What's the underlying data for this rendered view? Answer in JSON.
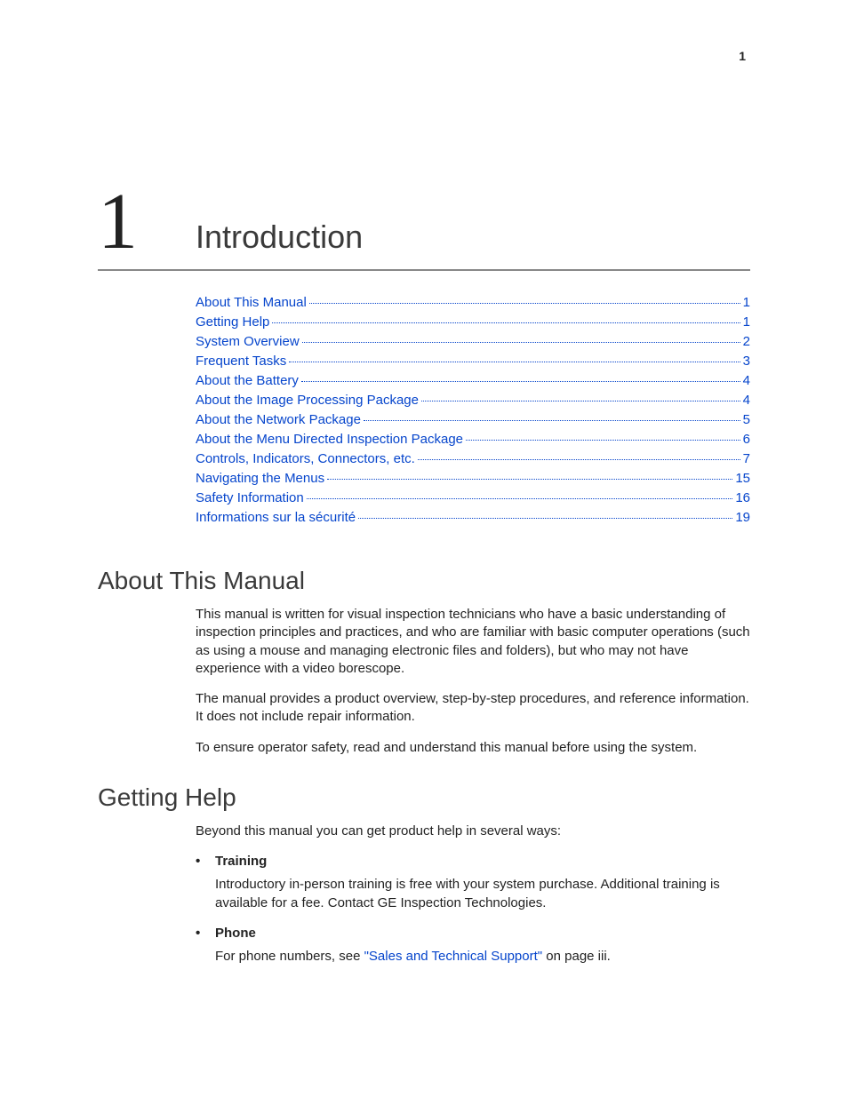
{
  "page_number_top": "1",
  "chapter": {
    "number": "1",
    "title": "Introduction"
  },
  "toc": [
    {
      "title": "About This Manual",
      "page": "1"
    },
    {
      "title": "Getting Help",
      "page": "1"
    },
    {
      "title": "System Overview",
      "page": "2"
    },
    {
      "title": "Frequent Tasks",
      "page": "3"
    },
    {
      "title": "About the Battery",
      "page": "4"
    },
    {
      "title": "About the Image Processing Package",
      "page": "4"
    },
    {
      "title": "About the Network Package",
      "page": "5"
    },
    {
      "title": "About the Menu Directed Inspection Package",
      "page": "6"
    },
    {
      "title": "Controls, Indicators, Connectors, etc.",
      "page": "7"
    },
    {
      "title": "Navigating the Menus",
      "page": "15"
    },
    {
      "title": "Safety Information",
      "page": "16"
    },
    {
      "title": "Informations sur la sécurité",
      "page": "19"
    }
  ],
  "sections": {
    "about_manual": {
      "heading": "About This Manual",
      "p1": "This manual is written for visual inspection technicians who have a basic understanding of inspection principles and practices, and who are familiar with basic computer operations (such as using a mouse and managing electronic files and folders), but who may not have experience with a video borescope.",
      "p2": "The manual provides a product overview, step-by-step procedures, and reference information. It does not include repair information.",
      "p3": "To ensure operator safety, read and understand this manual before using the system."
    },
    "getting_help": {
      "heading": "Getting Help",
      "intro": "Beyond this manual you can get product help in several ways:",
      "items": [
        {
          "label": "Training",
          "body": "Introductory in-person training is free with your system purchase. Additional training is available for a fee. Contact GE Inspection Technologies."
        },
        {
          "label": "Phone",
          "body_prefix": "For phone numbers, see ",
          "link_text": "\"Sales and Technical Support\"",
          "body_suffix": " on page iii."
        }
      ]
    }
  }
}
